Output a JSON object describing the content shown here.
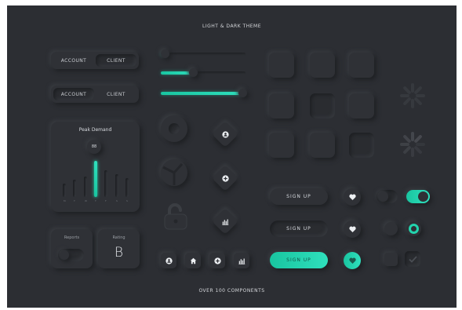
{
  "header": {
    "title": "LIGHT & DARK THEME"
  },
  "footer": {
    "title": "OVER 100 COMPONENTS"
  },
  "segmented": [
    {
      "left": "ACCOUNT",
      "right": "CLIENT",
      "active": "right"
    },
    {
      "left": "ACCOUNT",
      "right": "CLIENT",
      "active": "left"
    }
  ],
  "chart_card": {
    "title": "Peak Demand",
    "value": "88",
    "days": [
      "M",
      "T",
      "W",
      "T",
      "F",
      "S",
      "S"
    ],
    "bars": [
      0.35,
      0.45,
      0.55,
      0.95,
      0.7,
      0.6,
      0.5
    ],
    "highlight_index": 3
  },
  "sliders": [
    {
      "value": 0.05
    },
    {
      "value": 0.38
    },
    {
      "value": 0.97
    }
  ],
  "reports_card": {
    "label": "Reports",
    "toggle": "off"
  },
  "rating_card": {
    "label": "Rating",
    "value": "B"
  },
  "diamond_icons": [
    "user-icon",
    "plus-icon",
    "bar-chart-icon"
  ],
  "icon_row": [
    "user-icon",
    "home-icon",
    "plus-icon",
    "bar-chart-icon"
  ],
  "signup_buttons": [
    {
      "label": "SIGN UP",
      "state": "raised"
    },
    {
      "label": "SIGN UP",
      "state": "pressed"
    },
    {
      "label": "SIGN UP",
      "state": "active"
    }
  ],
  "heart_buttons": [
    "raised",
    "pressed",
    "active"
  ],
  "toggles": [
    {
      "kind": "switch",
      "state": "off"
    },
    {
      "kind": "switch",
      "state": "on"
    },
    {
      "kind": "radio",
      "state": "off"
    },
    {
      "kind": "radio",
      "state": "on"
    },
    {
      "kind": "checkbox",
      "state": "off"
    },
    {
      "kind": "checkbox",
      "state": "on"
    }
  ],
  "colors": {
    "background": "#2c2e33",
    "accent": "#22d3ad",
    "text": "#d6d8dc"
  }
}
